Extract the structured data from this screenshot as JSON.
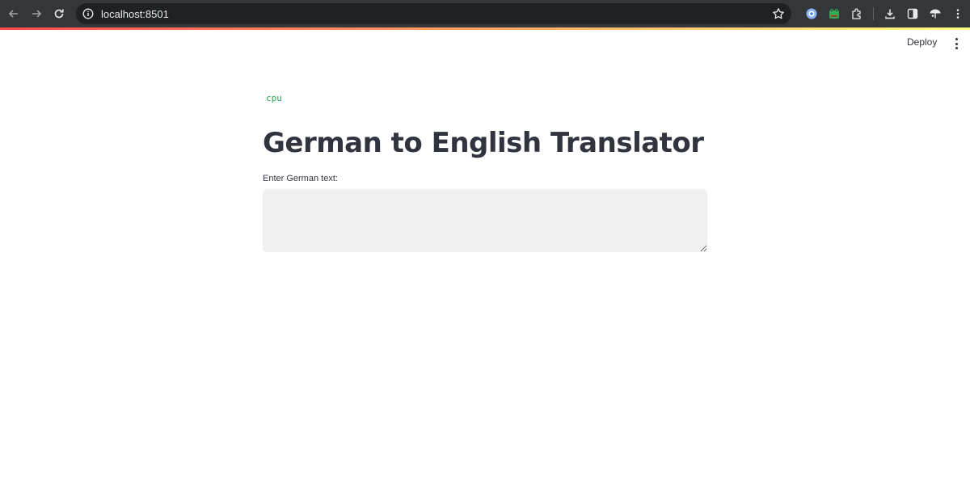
{
  "browser": {
    "url": "localhost:8501"
  },
  "icons": {
    "back": "arrow-left-icon",
    "forward": "arrow-right-icon",
    "reload": "reload-icon",
    "site_info": "info-icon",
    "bookmark": "star-icon",
    "extensions": "puzzle-icon",
    "downloads": "download-icon",
    "side_panel": "side-panel-icon",
    "profile": "profile-icon",
    "menu": "kebab-menu-icon"
  },
  "colors": {
    "accent": "#ff4b4b",
    "device_text": "#21a354",
    "text": "#31333f",
    "input_bg": "#f0f0f0"
  },
  "header": {
    "deploy_label": "Deploy"
  },
  "main": {
    "device": "cpu",
    "title": "German to English Translator",
    "input_label": "Enter German text:",
    "input_value": ""
  }
}
